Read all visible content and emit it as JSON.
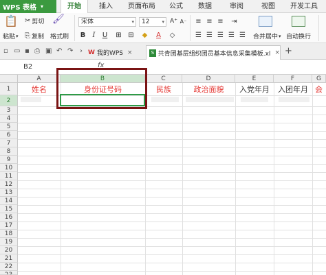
{
  "app": {
    "name": "WPS 表格"
  },
  "menu": {
    "tabs": [
      {
        "label": "开始",
        "active": true
      },
      {
        "label": "插入"
      },
      {
        "label": "页面布局"
      },
      {
        "label": "公式"
      },
      {
        "label": "数据"
      },
      {
        "label": "审阅"
      },
      {
        "label": "视图"
      },
      {
        "label": "开发工具"
      }
    ]
  },
  "ribbon": {
    "paste": "粘贴",
    "cut": "剪切",
    "copy": "复制",
    "format_painter": "格式刷",
    "font_name": "宋体",
    "font_size": "12",
    "merge_center": "合并居中",
    "wrap_text": "自动换行"
  },
  "doc_tabs": [
    {
      "label": "我的WPS"
    },
    {
      "label": "共青团基层组织团员基本信息采集模板.xls"
    }
  ],
  "formula_bar": {
    "name_box": "B2",
    "fx": "fx",
    "value": ""
  },
  "grid": {
    "columns": [
      "A",
      "B",
      "C",
      "D",
      "E",
      "F",
      "G"
    ],
    "rows": [
      "1",
      "2",
      "3",
      "4",
      "5",
      "6",
      "7",
      "8",
      "9",
      "10",
      "11",
      "12",
      "13",
      "14",
      "15",
      "16",
      "17",
      "18",
      "19",
      "20",
      "21",
      "22",
      "23"
    ],
    "selected_column": "B",
    "selected_row": "2",
    "header_row": [
      "姓名",
      "身份证号码",
      "民族",
      "政治面貌",
      "入党年月",
      "入团年月",
      "会"
    ]
  },
  "colors": {
    "accent": "#2e7d32",
    "header_text": "#e53935",
    "highlight_frame": "#7a1414",
    "selection_border": "#2e9b47"
  }
}
